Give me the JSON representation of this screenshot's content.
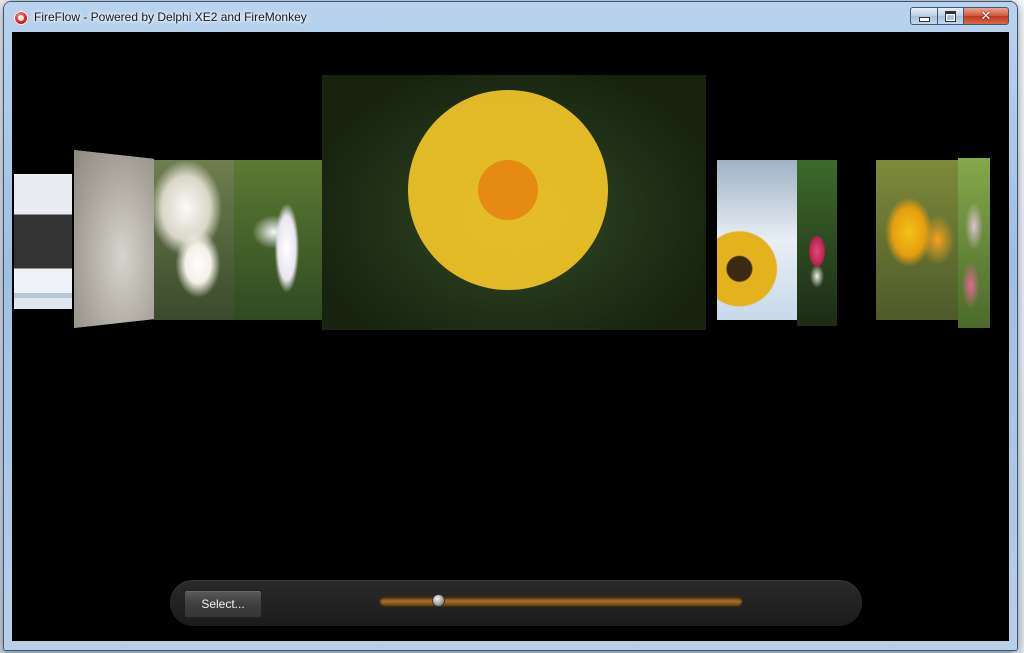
{
  "window": {
    "title": "FireFlow - Powered by Delphi XE2 and FireMonkey",
    "icon": "fireflow-app-icon"
  },
  "caption_buttons": {
    "minimize": "minimize-icon",
    "maximize": "maximize-icon",
    "close": "✕"
  },
  "gallery": {
    "covers_left": [
      "screenshot",
      "grey-texture",
      "white-chrysanthemum",
      "white-lily"
    ],
    "cover_center": "yellow-gerbera",
    "covers_right": [
      "sunflower",
      "pink-flowers",
      "yellow-flowers",
      "pink-white-flowers"
    ]
  },
  "controls": {
    "select_label": "Select...",
    "slider_position": 0.15
  },
  "colors": {
    "background": "#000000",
    "slider_track": "#a66e25",
    "center_petal": "#f7c928"
  }
}
